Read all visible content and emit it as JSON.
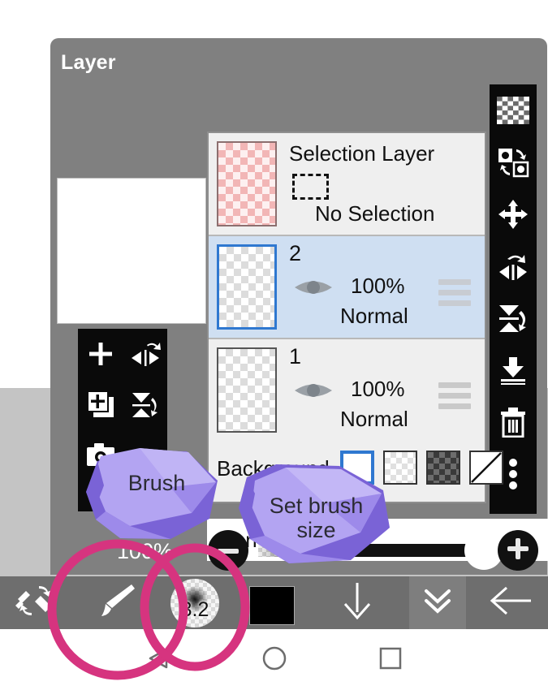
{
  "dialog": {
    "title": "Layer"
  },
  "layer_list": {
    "selection_layer": {
      "title": "Selection Layer",
      "status": "No Selection",
      "thumb": "pink-checkerboard-thumbnail"
    },
    "layers": [
      {
        "name": "2",
        "opacity": "100%",
        "blend": "Normal",
        "visible_icon": "eye-icon",
        "selected": true
      },
      {
        "name": "1",
        "opacity": "100%",
        "blend": "Normal",
        "visible_icon": "eye-icon",
        "selected": false
      }
    ],
    "background": {
      "label": "Background",
      "swatches": [
        {
          "name": "white",
          "selected": true
        },
        {
          "name": "light-checkerboard",
          "selected": false
        },
        {
          "name": "dark-checkerboard",
          "selected": false
        },
        {
          "name": "none-diagonal",
          "selected": false
        }
      ]
    }
  },
  "blend_bar": {
    "selected_blend_mode": "Normal",
    "expand_icon": "triangle-up-icon"
  },
  "opacity_bar": {
    "value": "100%",
    "minus_icon": "minus-icon",
    "plus_icon": "plus-icon",
    "handle_position_percent": 100
  },
  "left_tools": [
    {
      "icon": "plus-icon",
      "label": "add-layer"
    },
    {
      "icon": "flip-horizontal-icon",
      "label": "flip-horizontal"
    },
    {
      "icon": "duplicate-layer-icon",
      "label": "duplicate-layer"
    },
    {
      "icon": "flip-vertical-icon",
      "label": "flip-vertical"
    },
    {
      "icon": "camera-icon",
      "label": "camera-import"
    }
  ],
  "right_tools": [
    {
      "icon": "transparency-checker-icon",
      "label": "alpha-lock"
    },
    {
      "icon": "swap-layers-icon",
      "label": "swap-layers"
    },
    {
      "icon": "move-icon",
      "label": "move-layer"
    },
    {
      "icon": "rotate-flip-horizontal-icon",
      "label": "rotate-flip-horizontal"
    },
    {
      "icon": "rotate-flip-vertical-icon",
      "label": "rotate-flip-vertical"
    },
    {
      "icon": "merge-down-icon",
      "label": "merge-down"
    },
    {
      "icon": "trash-icon",
      "label": "delete-layer"
    },
    {
      "icon": "more-vertical-icon",
      "label": "more-options"
    }
  ],
  "bottom_toolbar": {
    "brush_eraser_toggle_icon": "brush-eraser-swap-icon",
    "brush_icon": "brush-icon",
    "brush_size_value": "3.2",
    "color_swatch": "#000000",
    "down_arrow_icon": "arrow-down-icon",
    "chevrons_icon": "double-chevron-down-icon",
    "back_arrow_icon": "arrow-left-icon"
  },
  "nav_bar": {
    "back_icon": "triangle-back-icon",
    "home_icon": "circle-home-icon",
    "recents_icon": "square-recents-icon"
  },
  "annotations": {
    "callouts": [
      {
        "text": "Brush",
        "points_to": "brush-tool-button"
      },
      {
        "text": "Set brush size",
        "points_to": "brush-size-button"
      }
    ],
    "highlight_color": "#d6347f",
    "callout_color": "#b3a4f2",
    "circled_targets": [
      "brush-tool-button",
      "brush-size-button"
    ]
  }
}
